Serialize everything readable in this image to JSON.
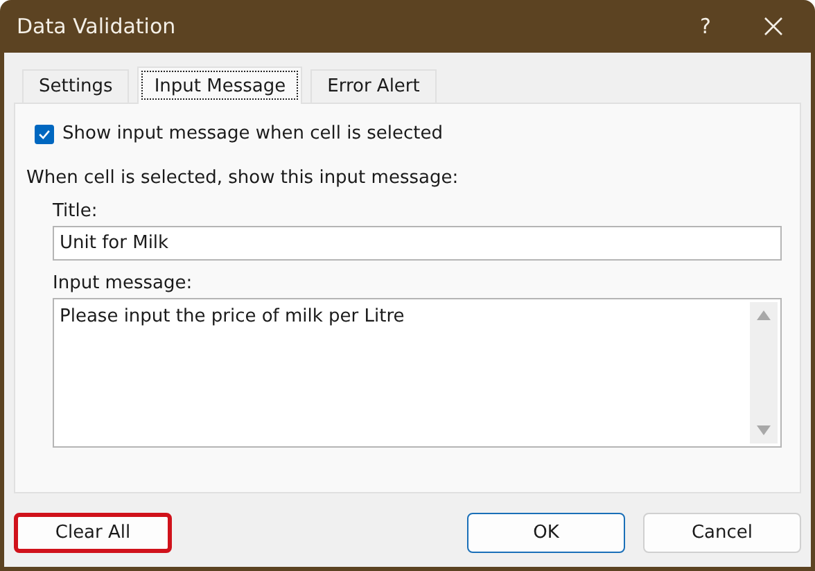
{
  "window": {
    "title": "Data Validation",
    "help": "?"
  },
  "tabs": [
    {
      "label": "Settings",
      "selected": false
    },
    {
      "label": "Input Message",
      "selected": true
    },
    {
      "label": "Error Alert",
      "selected": false
    }
  ],
  "show_message": {
    "label": "Show input message when cell is selected",
    "checked": true
  },
  "section_label": "When cell is selected, show this input message:",
  "title_field": {
    "label": "Title:",
    "value": "Unit for Milk"
  },
  "message_field": {
    "label": "Input message:",
    "value": "Please input the price of milk per Litre"
  },
  "buttons": [
    {
      "label": "Clear All",
      "highlighted": true,
      "default": false
    },
    {
      "label": "OK",
      "highlighted": false,
      "default": true
    },
    {
      "label": "Cancel",
      "highlighted": false,
      "default": false
    }
  ]
}
